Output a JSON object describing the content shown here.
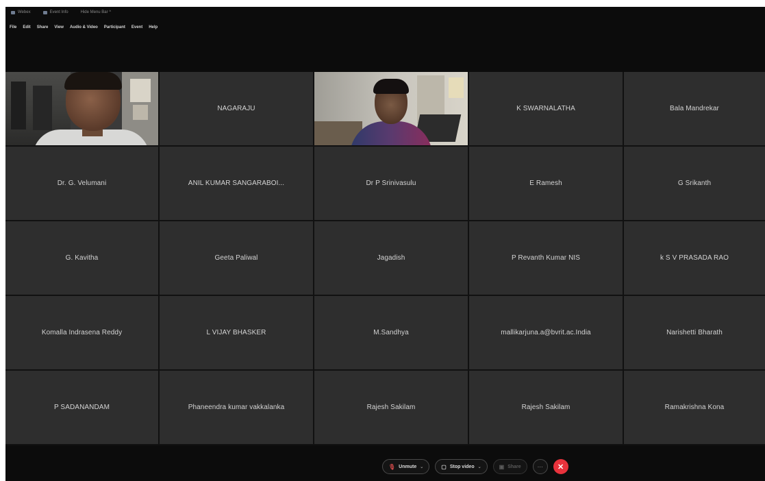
{
  "titlebar": {
    "items": [
      {
        "icon": "app-logo-icon",
        "label": "Webex"
      },
      {
        "icon": "meeting-info-icon",
        "label": "Event Info"
      },
      {
        "icon": "",
        "label": "Hide Menu Bar ^"
      }
    ]
  },
  "menubar": {
    "items": [
      "File",
      "Edit",
      "Share",
      "View",
      "Audio & Video",
      "Participant",
      "Event",
      "Help"
    ]
  },
  "participants": [
    {
      "name": "",
      "video": true
    },
    {
      "name": "NAGARAJU",
      "video": false
    },
    {
      "name": "",
      "video": true
    },
    {
      "name": "K SWARNALATHA",
      "video": false
    },
    {
      "name": "Bala Mandrekar",
      "video": false
    },
    {
      "name": "Dr. G. Velumani",
      "video": false
    },
    {
      "name": "ANIL KUMAR SANGARABOI...",
      "video": false
    },
    {
      "name": "Dr P Srinivasulu",
      "video": false
    },
    {
      "name": "E Ramesh",
      "video": false
    },
    {
      "name": "G Srikanth",
      "video": false
    },
    {
      "name": "G. Kavitha",
      "video": false
    },
    {
      "name": "Geeta Paliwal",
      "video": false
    },
    {
      "name": "Jagadish",
      "video": false
    },
    {
      "name": "P Revanth Kumar NIS",
      "video": false
    },
    {
      "name": "k S V PRASADA RAO",
      "video": false
    },
    {
      "name": "Komalla Indrasena Reddy",
      "video": false
    },
    {
      "name": "L VIJAY BHASKER",
      "video": false
    },
    {
      "name": "M.Sandhya",
      "video": false
    },
    {
      "name": "mallikarjuna.a@bvrit.ac.India",
      "video": false
    },
    {
      "name": "Narishetti Bharath",
      "video": false
    },
    {
      "name": "P SADANANDAM",
      "video": false
    },
    {
      "name": "Phaneendra kumar vakkalanka",
      "video": false
    },
    {
      "name": "Rajesh Sakilam",
      "video": false
    },
    {
      "name": "Rajesh Sakilam",
      "video": false
    },
    {
      "name": "Ramakrishna Kona",
      "video": false
    }
  ],
  "controls": {
    "unmute_label": "Unmute",
    "stop_video_label": "Stop video",
    "share_label": "Share",
    "more_label": "···",
    "end_label": "✕"
  },
  "colors": {
    "background": "#0c0c0c",
    "tile": "#2e2e2e",
    "end_button": "#e8323c",
    "mute_icon": "#d04a4a"
  }
}
